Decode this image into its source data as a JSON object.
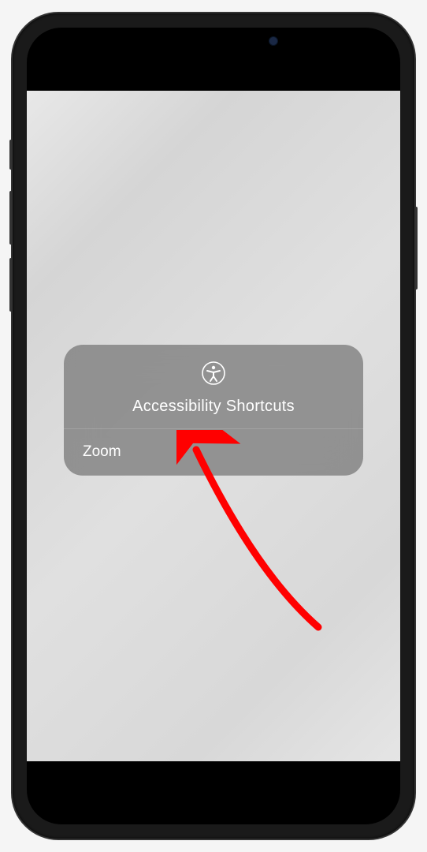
{
  "dialog": {
    "title": "Accessibility Shortcuts",
    "options": [
      {
        "label": "Zoom"
      }
    ]
  },
  "annotation": {
    "arrow_color": "#ff0000"
  }
}
